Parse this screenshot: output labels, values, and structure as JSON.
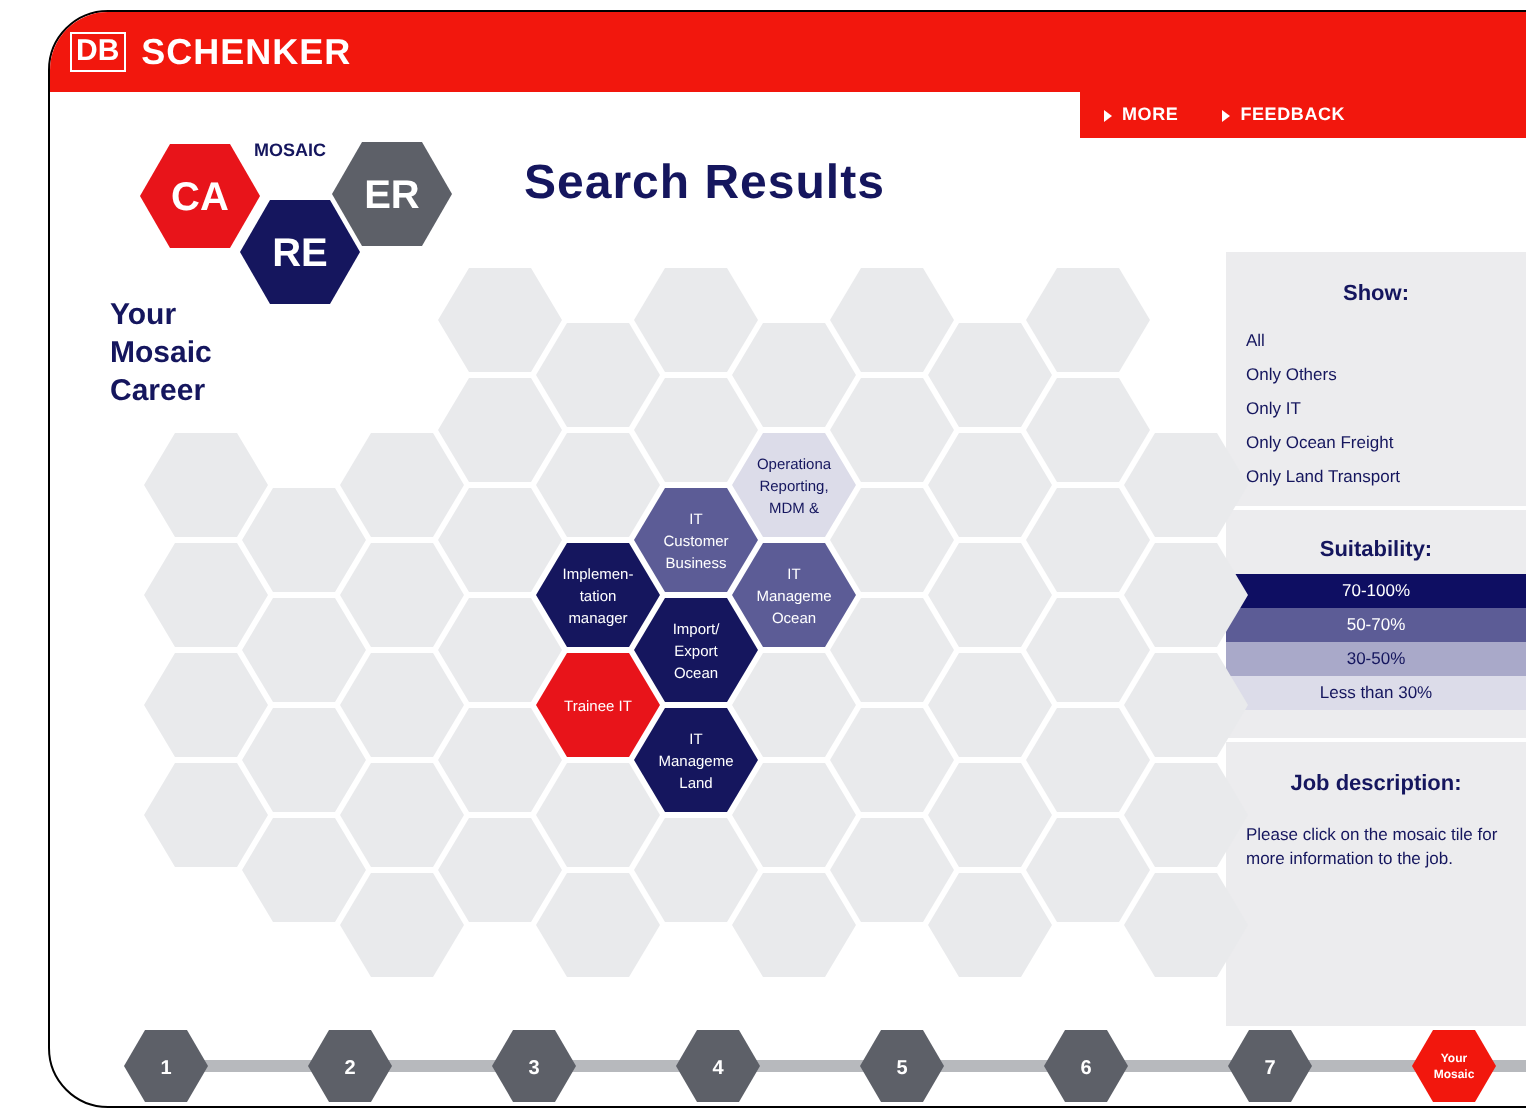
{
  "header": {
    "brand_mark": "DB",
    "brand": "SCHENKER",
    "links": [
      "MORE",
      "FEEDBACK"
    ]
  },
  "logo": {
    "caption": "MOSAIC",
    "tiles": [
      {
        "text": "CA",
        "color": "#e8141a"
      },
      {
        "text": "RE",
        "color": "#15165e"
      },
      {
        "text": "ER",
        "color": "#5d6068"
      }
    ]
  },
  "tagline": "Your Mosaic Career",
  "title": "Search Results",
  "tiles": [
    {
      "lines": [
        "Operationa",
        "Reporting,",
        "MDM &"
      ],
      "color": "#dcdce9"
    },
    {
      "lines": [
        "IT",
        "Customer",
        "Business"
      ],
      "color": "#5c5c96"
    },
    {
      "lines": [
        "Implemen-",
        "tation",
        "manager"
      ],
      "color": "#15165e"
    },
    {
      "lines": [
        "IT",
        "Manageme",
        "Ocean"
      ],
      "color": "#5c5c96"
    },
    {
      "lines": [
        "Import/",
        "Export",
        "Ocean"
      ],
      "color": "#15165e"
    },
    {
      "lines": [
        "Trainee IT"
      ],
      "color": "#e8141a"
    },
    {
      "lines": [
        "IT",
        "Manageme",
        "Land"
      ],
      "color": "#15165e"
    }
  ],
  "show": {
    "heading": "Show:",
    "options": [
      "All",
      "Only Others",
      "Only IT",
      "Only Ocean Freight",
      "Only Land Transport"
    ]
  },
  "suitability": {
    "heading": "Suitability:",
    "bands": [
      {
        "label": "70-100%",
        "color": "#0e0e62"
      },
      {
        "label": "50-70%",
        "color": "#5c5c96"
      },
      {
        "label": "30-50%",
        "color": "#a9a9c9"
      },
      {
        "label": "Less than 30%",
        "color": "#dcdce9"
      }
    ]
  },
  "job_description": {
    "heading": "Job description:",
    "text": "Please click on the mosaic tile for more information to the job."
  },
  "steps": [
    {
      "label": "1",
      "selected": false
    },
    {
      "label": "2",
      "selected": false
    },
    {
      "label": "3",
      "selected": false
    },
    {
      "label": "4",
      "selected": false
    },
    {
      "label": "5",
      "selected": false
    },
    {
      "label": "6",
      "selected": false
    },
    {
      "label": "7",
      "selected": false
    },
    {
      "label": "Your Mosaic",
      "selected": true
    }
  ]
}
